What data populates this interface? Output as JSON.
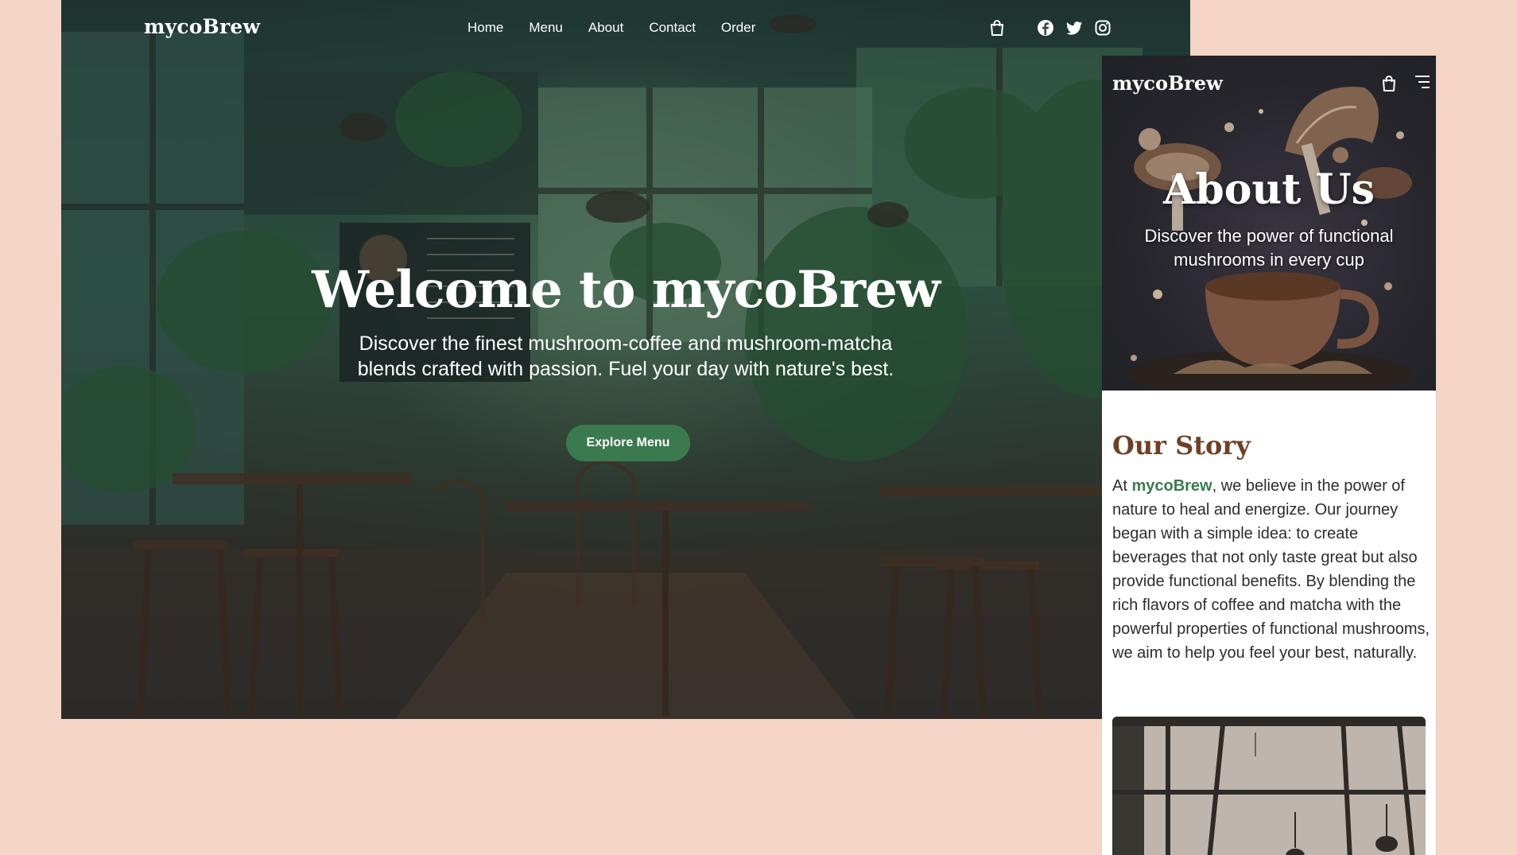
{
  "desktop": {
    "logo": "mycoBrew",
    "nav": [
      "Home",
      "Menu",
      "About",
      "Contact",
      "Order"
    ],
    "icons": {
      "cart": "shopping-bag-icon",
      "social": [
        "facebook-icon",
        "twitter-icon",
        "instagram-icon"
      ]
    },
    "hero": {
      "title": "Welcome to mycoBrew",
      "subtitle": "Discover the finest mushroom-coffee and mushroom-matcha blends crafted with passion. Fuel your day with nature's best.",
      "cta": "Explore Menu"
    }
  },
  "mobile": {
    "logo": "mycoBrew",
    "icons": {
      "cart": "shopping-bag-icon",
      "menu": "hamburger-menu-icon"
    },
    "hero": {
      "title": "About Us",
      "subtitle": "Discover the power of functional mushrooms in every cup"
    },
    "story": {
      "heading": "Our Story",
      "prefix": "At ",
      "brand": "mycoBrew",
      "text": ", we believe in the power of nature to heal and energize. Our journey began with a simple idea: to create beverages that not only taste great but also provide functional benefits. By blending the rich flavors of coffee and matcha with the powerful properties of functional mushrooms, we aim to help you feel your best, naturally."
    }
  },
  "colors": {
    "background": "#f5d6c6",
    "accent_green": "#3b7a4f",
    "heading_brown": "#6e4124",
    "mobile_hero_dark": "#27262d"
  }
}
